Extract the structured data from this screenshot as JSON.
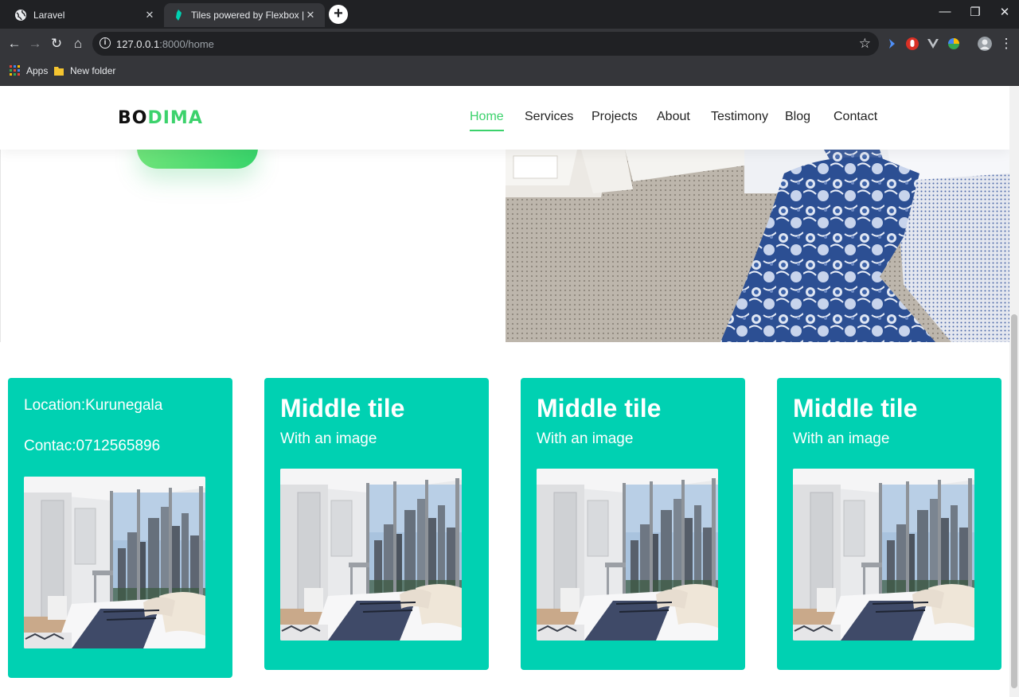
{
  "browser": {
    "tabs": [
      {
        "title": "Laravel",
        "active": false
      },
      {
        "title": "Tiles powered by Flexbox | Bulma",
        "active": true
      }
    ],
    "url_host": "127.0.0.1",
    "url_path": ":8000/home",
    "bookmarks": [
      {
        "label": "Apps",
        "icon": "apps-grid-icon"
      },
      {
        "label": "New folder",
        "icon": "folder-icon"
      }
    ]
  },
  "site": {
    "logo_part1": "BO",
    "logo_part2": "DIMA",
    "brand_color": "#3cd26c",
    "nav": [
      {
        "label": "Home",
        "active": true
      },
      {
        "label": "Services",
        "active": false
      },
      {
        "label": "Projects",
        "active": false
      },
      {
        "label": "About",
        "active": false
      },
      {
        "label": "Testimony",
        "active": false
      },
      {
        "label": "Blog",
        "active": false
      },
      {
        "label": "Contact",
        "active": false
      }
    ]
  },
  "tiles": {
    "color": "#00d1b2",
    "info": {
      "location": "Location:Kurunegala",
      "contact": "Contac:0712565896"
    },
    "middle": [
      {
        "title": "Middle tile",
        "subtitle": "With an image"
      },
      {
        "title": "Middle tile",
        "subtitle": "With an image"
      },
      {
        "title": "Middle tile",
        "subtitle": "With an image"
      }
    ]
  }
}
